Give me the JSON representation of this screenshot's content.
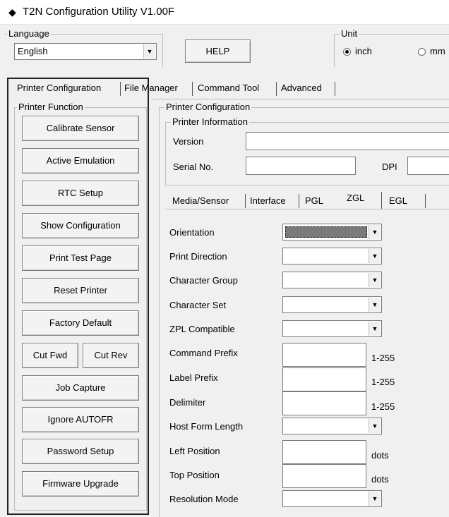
{
  "window": {
    "title": "T2N Configuration Utility V1.00F",
    "app_icon": "diamond-icon"
  },
  "language": {
    "legend": "Language",
    "selected": "English"
  },
  "help_label": "HELP",
  "unit": {
    "legend": "Unit",
    "options": [
      "inch",
      "mm"
    ],
    "selected": "inch"
  },
  "main_tabs": [
    "Printer Configuration",
    "File Manager",
    "Command Tool",
    "Advanced"
  ],
  "printer_function": {
    "legend": "Printer Function",
    "buttons": [
      "Calibrate Sensor",
      "Active Emulation",
      "RTC Setup",
      "Show Configuration",
      "Print Test Page",
      "Reset Printer",
      "Factory Default"
    ],
    "cut_fwd": "Cut Fwd",
    "cut_rev": "Cut Rev",
    "buttons2": [
      "Job Capture",
      "Ignore AUTOFR",
      "Password Setup",
      "Firmware Upgrade"
    ]
  },
  "printer_config": {
    "legend": "Printer Configuration",
    "info_legend": "Printer Information",
    "version_label": "Version",
    "serial_label": "Serial No.",
    "dpi_label": "DPI"
  },
  "sub_tabs": [
    "Media/Sensor",
    "Interface",
    "PGL",
    "ZGL",
    "EGL"
  ],
  "zgl": {
    "orientation": "Orientation",
    "print_direction": "Print Direction",
    "character_group": "Character Group",
    "character_set": "Character Set",
    "zpl_compatible": "ZPL Compatible",
    "command_prefix": "Command Prefix",
    "label_prefix": "Label Prefix",
    "delimiter": "Delimiter",
    "host_form_length": "Host Form Length",
    "left_position": "Left Position",
    "top_position": "Top Position",
    "resolution_mode": "Resolution Mode",
    "range": "1-255",
    "dots": "dots"
  },
  "colors": {
    "selected_combo": "#7a7a7a",
    "highlight_border": "#222222"
  }
}
